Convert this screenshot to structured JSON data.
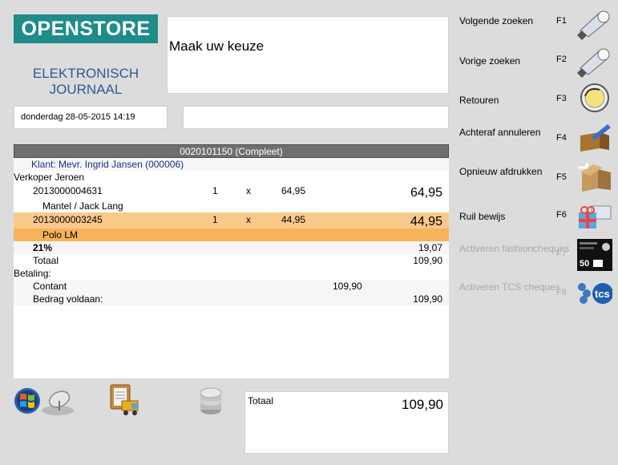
{
  "logo": {
    "text": "OPENSTORE",
    "color": "#1e8c88"
  },
  "journal_title": {
    "line1": "ELEKTRONISCH",
    "line2": "JOURNAAL"
  },
  "prompt": "Maak uw keuze",
  "date": "donderdag 28-05-2015 14:19",
  "receipt": {
    "header": "0020101150 (Compleet)",
    "customer": "Klant: Mevr. Ingrid Jansen (000006)",
    "seller": "Verkoper Jeroen",
    "lines": [
      {
        "code": "2013000004631",
        "qty": "1",
        "x": "x",
        "price": "64,95",
        "total": "64,95",
        "desc": "Mantel / Jack Lang"
      },
      {
        "code": "2013000003245",
        "qty": "1",
        "x": "x",
        "price": "44,95",
        "total": "44,95",
        "desc": "Polo LM"
      }
    ],
    "vat_label": "21%",
    "vat_value": "19,07",
    "total_label": "Totaal",
    "total_value": "109,90",
    "payment_label": "Betaling:",
    "cash_label": "Contant",
    "cash_value": "109,90",
    "paid_label": "Bedrag voldaan:",
    "paid_value": "109,90"
  },
  "bottom_total": {
    "label": "Totaal",
    "value": "109,90"
  },
  "functions": [
    {
      "label": "Volgende zoeken",
      "key": "F1",
      "icon": "flashlight-icon",
      "enabled": true
    },
    {
      "label": "Vorige zoeken",
      "key": "F2",
      "icon": "flashlight-icon",
      "enabled": true
    },
    {
      "label": "Retouren",
      "key": "F3",
      "icon": "return-clock-icon",
      "enabled": true
    },
    {
      "label": "Achteraf annuleren",
      "key": "F4",
      "icon": "cancel-box-icon",
      "enabled": true
    },
    {
      "label": "Opnieuw afdrukken",
      "key": "F5",
      "icon": "reprint-box-icon",
      "enabled": true
    },
    {
      "label": "Ruil bewijs",
      "key": "F6",
      "icon": "gift-icon",
      "enabled": true
    },
    {
      "label": "Activeren fashioncheques",
      "key": "F7",
      "icon": "fashioncheque-card-icon",
      "enabled": false
    },
    {
      "label": "Activeren TCS cheques",
      "key": "F8",
      "icon": "tcs-logo-icon",
      "enabled": false
    }
  ],
  "colors": {
    "selected_row": "#f7b35a",
    "header_bar": "#6f6f6f",
    "customer_text": "#1d2f86"
  }
}
